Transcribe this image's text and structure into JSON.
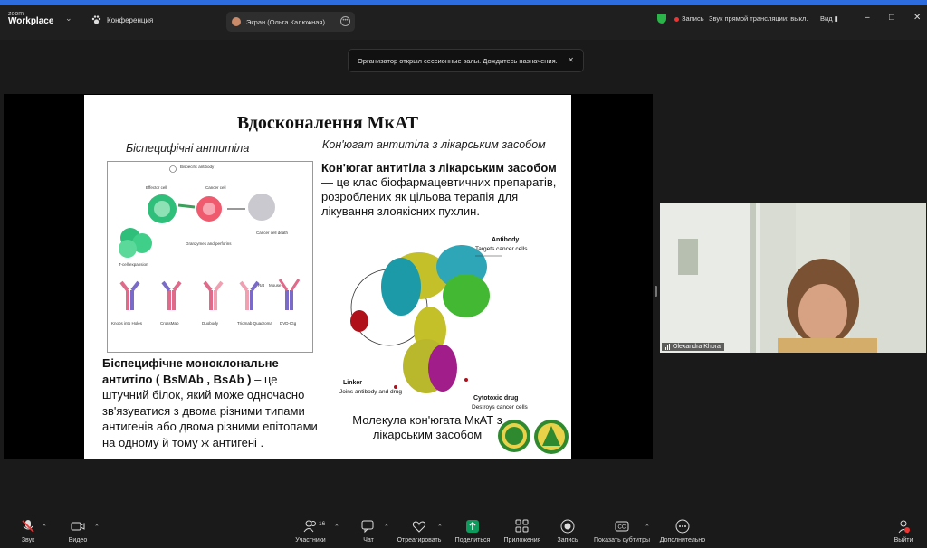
{
  "app": {
    "logo_top": "zoom",
    "logo_bottom": "Workplace"
  },
  "topbar": {
    "conference_label": "Конференция",
    "share_tab_label": "Экран (Ольга Калюжная)",
    "recording_label": "Запись",
    "stream_audio_label": "Звук прямой трансляции: выкл.",
    "view_label": "Вид"
  },
  "notification": {
    "text": "Организатор открыл сессионные залы. Дождитесь назначения."
  },
  "slide": {
    "title": "Вдосконалення МкАТ",
    "left_subtitle": "Біспецифічні антитіла",
    "right_subtitle": "Кон'югат антитіла з лікарським засобом",
    "intro_bold": "Кон'югат антитіла з лікарським засобом",
    "intro_rest": " — це клас біофармацевтичних препаратів, розроблених як цільова терапія для лікування злоякісних пухлин.",
    "desc_bold": "Біспецифічне моноклональне антитіло ( BsMAb , BsAb )",
    "desc_rest": " – це штучний білок, який може одночасно зв'язуватися з двома різними типами антигенів або двома різними епітопами на одному й тому ж антигені .",
    "caption": "Молекула кон'югата МкАТ з лікарським засобом",
    "diagram": {
      "bispecific": "Bispecific antibody",
      "effector": "Effector cell",
      "cancer": "Cancer cell",
      "granzymes": "Granzymes and perforins",
      "death": "Cancer cell death",
      "tcell": "T-cell expansion",
      "formats": [
        "Knobs into Holes",
        "CrossMab",
        "Duobody",
        "Triomab Quadroma",
        "DVD-IGg"
      ],
      "rat": "Rat",
      "mouse": "Mouse"
    },
    "molecule": {
      "antibody_title": "Antibody",
      "antibody_sub": "Targets cancer cells",
      "linker_title": "Linker",
      "linker_sub": "Joins antibody and drug",
      "drug_title": "Cytotoxic drug",
      "drug_sub": "Destroys cancer cells"
    }
  },
  "participant": {
    "name": "Olexandra Khora"
  },
  "toolbar": {
    "audio": "Звук",
    "video": "Видео",
    "participants": "Участники",
    "participants_count": "16",
    "chat": "Чат",
    "react": "Отреагировать",
    "share": "Поделиться",
    "apps": "Приложения",
    "record": "Запись",
    "captions": "Показать субтитры",
    "more": "Дополнительно",
    "leave": "Выйти"
  },
  "colors": {
    "accent": "#2d6cdf",
    "share_green": "#0e9a5c",
    "record_red": "#e33333",
    "security_green": "#2cb34a"
  }
}
